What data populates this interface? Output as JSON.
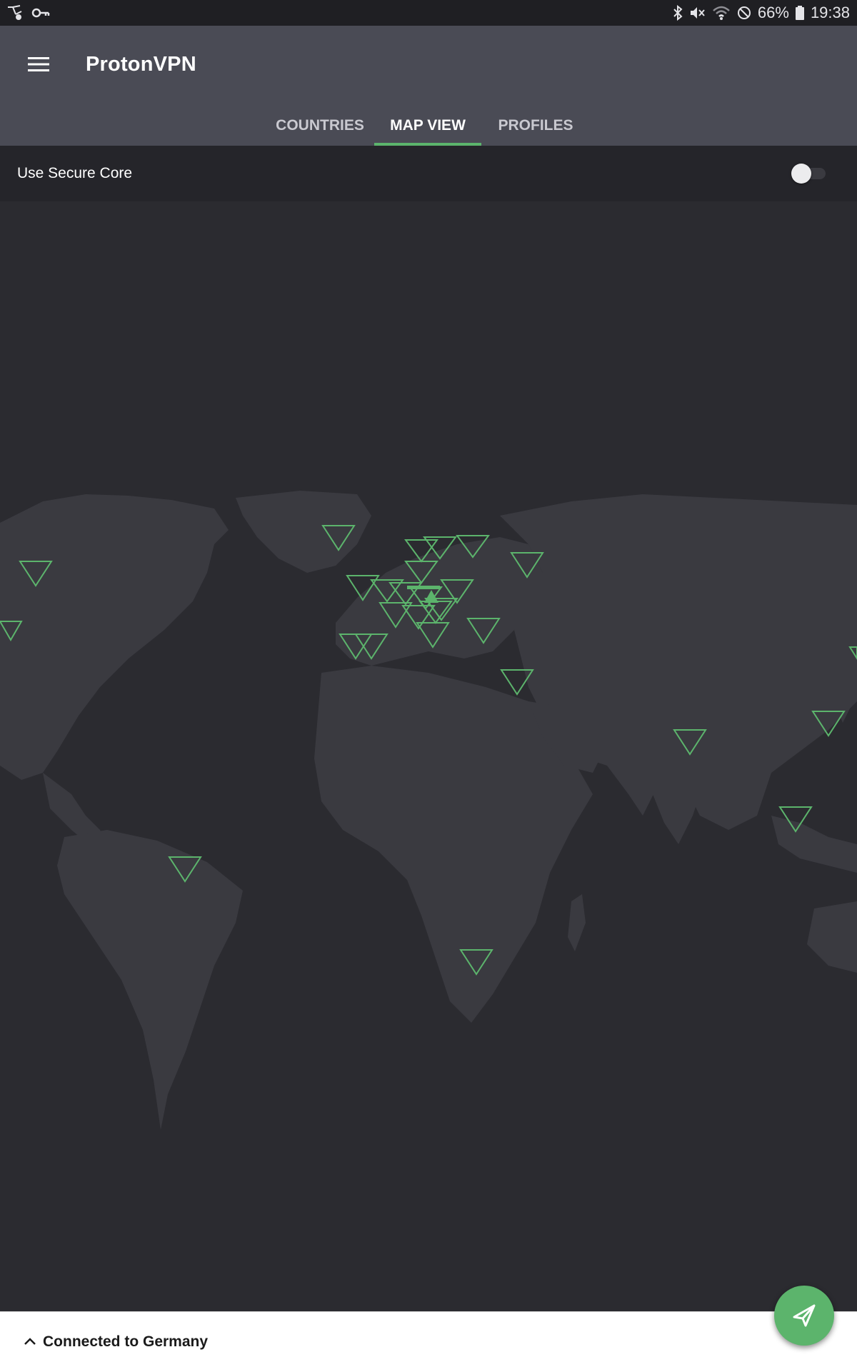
{
  "status_bar": {
    "battery": "66%",
    "time": "19:38",
    "left_icons": [
      "vpn-route-icon",
      "key-icon"
    ],
    "right_icons": [
      "bluetooth-icon",
      "mute-icon",
      "wifi-icon",
      "do-not-disturb-icon",
      "battery-icon"
    ]
  },
  "app_bar": {
    "title": "ProtonVPN",
    "menu_icon": "hamburger-menu-icon"
  },
  "tabs": [
    {
      "label": "COUNTRIES",
      "active": false
    },
    {
      "label": "MAP VIEW",
      "active": true
    },
    {
      "label": "PROFILES",
      "active": false
    }
  ],
  "secure_core": {
    "label": "Use Secure Core",
    "enabled": false
  },
  "map": {
    "marker_color": "#5cb46c",
    "land_color": "#3a3a40",
    "connected_country": "Germany"
  },
  "bottom_bar": {
    "status": "Connected to Germany",
    "expand_icon": "chevron-up-icon"
  },
  "fab": {
    "icon": "connect-arrow-icon",
    "color": "#5cb46c"
  }
}
